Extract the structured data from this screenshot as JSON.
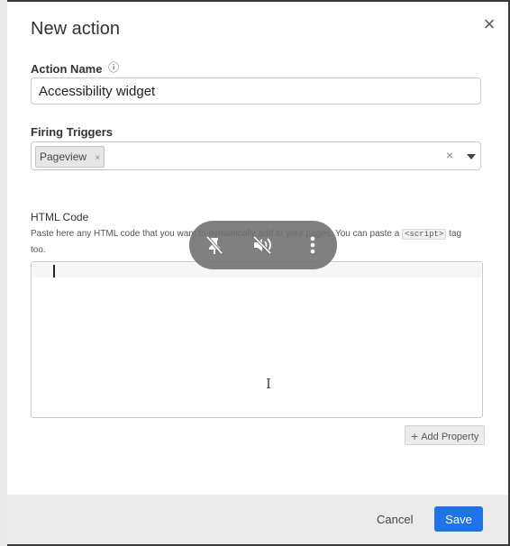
{
  "dialog": {
    "title": "New action",
    "close_label": "×"
  },
  "action_name": {
    "label": "Action Name",
    "info_icon": "info-icon",
    "value": "Accessibility widget"
  },
  "firing_triggers": {
    "label": "Firing Triggers",
    "chips": [
      "Pageview"
    ],
    "chip_remove": "×",
    "clear_label": "×"
  },
  "html_code": {
    "label": "HTML Code",
    "help_before": "Paste here any HTML code that you want to dynamically add to your pages. You can paste a",
    "help_code": "<script>",
    "help_after": "tag too.",
    "value": ""
  },
  "add_property": {
    "plus": "+",
    "label": "Add Property"
  },
  "footer": {
    "cancel_label": "Cancel",
    "save_label": "Save"
  },
  "overlay": {
    "icons": [
      "pin-off-icon",
      "volume-mute-icon",
      "more-vertical-icon"
    ]
  },
  "colors": {
    "primary": "#1e73e8",
    "footer_bg": "#ebebeb",
    "overlay_bg": "#6e6e6e"
  }
}
